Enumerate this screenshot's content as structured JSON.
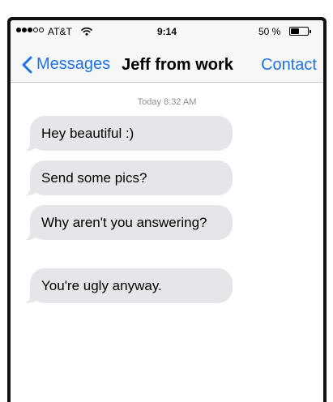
{
  "status_bar": {
    "carrier": "AT&T",
    "time": "9:14",
    "battery": "50 %",
    "battery_level": 0.5,
    "signal_bars_filled": 3,
    "signal_bars_total": 5
  },
  "nav": {
    "back_label": "Messages",
    "title": "Jeff from work",
    "contact_label": "Contact"
  },
  "conversation": {
    "timestamp": "Today 8:32 AM",
    "messages": [
      {
        "text": "Hey beautiful :)"
      },
      {
        "text": "Send some pics?"
      },
      {
        "text": "Why aren't you answering?"
      },
      {
        "text": "You're ugly anyway."
      }
    ]
  },
  "colors": {
    "accent": "#1a73e8",
    "bubble": "#e5e5ea"
  }
}
